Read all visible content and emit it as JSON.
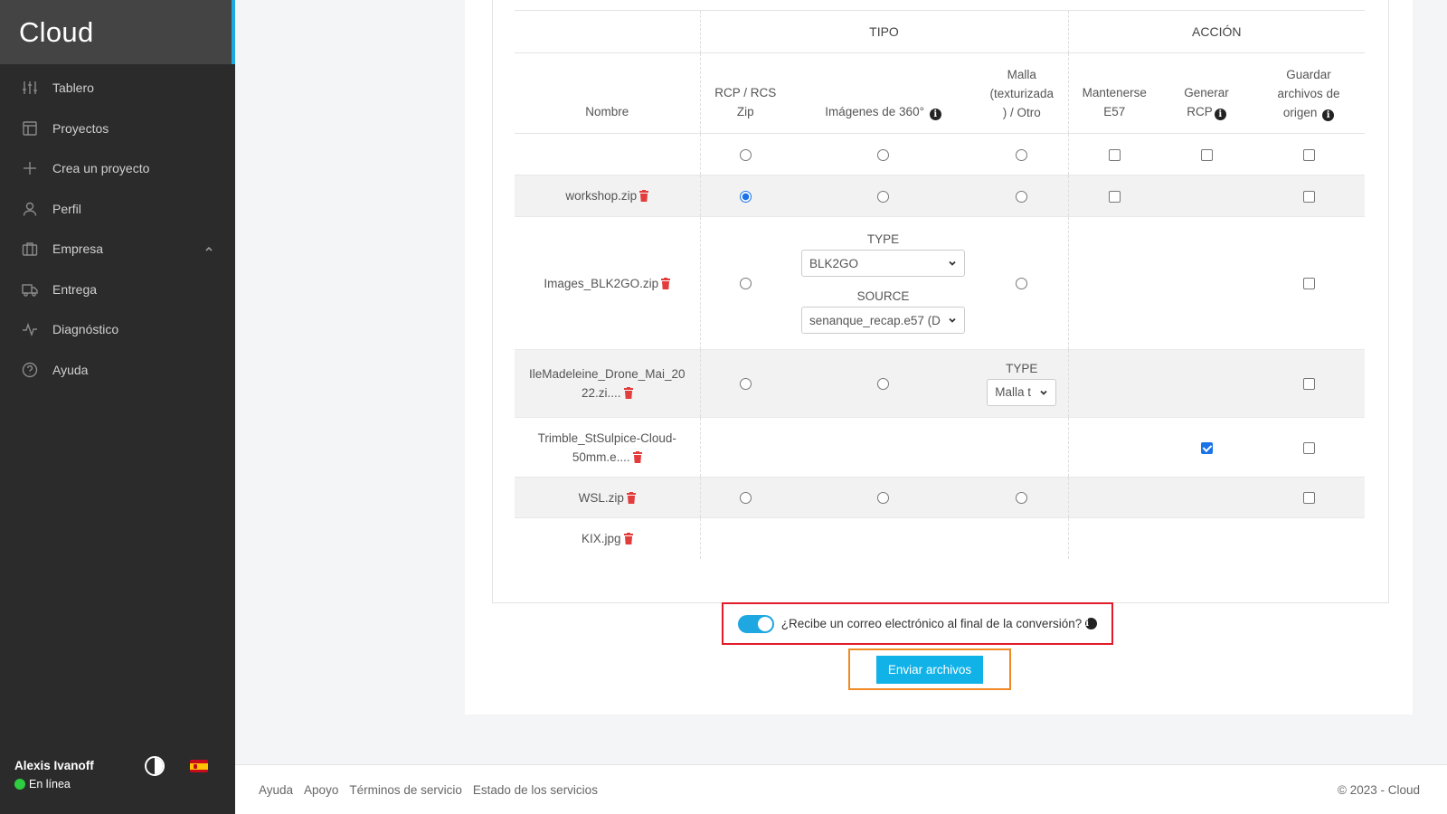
{
  "brand": "Cloud",
  "nav": [
    {
      "label": "Tablero",
      "icon": "sliders-icon"
    },
    {
      "label": "Proyectos",
      "icon": "layout-icon"
    },
    {
      "label": "Crea un proyecto",
      "icon": "plus-icon"
    },
    {
      "label": "Perfil",
      "icon": "user-icon"
    },
    {
      "label": "Empresa",
      "icon": "briefcase-icon"
    },
    {
      "label": "Entrega",
      "icon": "truck-icon"
    },
    {
      "label": "Diagnóstico",
      "icon": "activity-icon"
    },
    {
      "label": "Ayuda",
      "icon": "help-circle-icon"
    }
  ],
  "user": {
    "name": "Alexis Ivanoff",
    "status": "En línea",
    "status_color": "#2ecc40"
  },
  "table": {
    "group_tipo": "TIPO",
    "group_accion": "ACCIÓN",
    "col_nombre": "Nombre",
    "col_rcp_1": "RCP / RCS",
    "col_rcp_2": "Zip",
    "col_360": "Imágenes de 360°",
    "col_malla_1": "Malla",
    "col_malla_2": "(texturizada",
    "col_malla_3": ") / Otro",
    "col_mant_1": "Mantenerse",
    "col_mant_2": "E57",
    "col_gen_1": "Generar",
    "col_gen_2": "RCP",
    "col_guard_1": "Guardar",
    "col_guard_2": "archivos de",
    "col_guard_3": "origen",
    "rows": [
      {
        "name": "workshop.zip"
      },
      {
        "name": "Images_BLK2GO.zip",
        "type_label": "TYPE",
        "type_value": "BLK2GO",
        "source_label": "SOURCE",
        "source_value": "senanque_recap.e57 (D"
      },
      {
        "name_1": "IleMadeleine_Drone_Mai_20",
        "name_2": "22.zi....",
        "type_label": "TYPE",
        "type_value": "Malla t"
      },
      {
        "name_1": "Trimble_StSulpice-Cloud-",
        "name_2": "50mm.e...."
      },
      {
        "name": "WSL.zip"
      },
      {
        "name": "KIX.jpg"
      }
    ]
  },
  "email_question": "¿Recibe un correo electrónico al final de la conversión?",
  "submit_label": "Enviar archivos",
  "footer": {
    "links": [
      "Ayuda",
      "Apoyo",
      "Términos de servicio",
      "Estado de los servicios"
    ],
    "copyright": "© 2023 - Cloud"
  },
  "colors": {
    "accent": "#10b2e8",
    "highlight_red": "#e21b2a",
    "highlight_orange": "#f08a24",
    "trash": "#e23c3c"
  }
}
